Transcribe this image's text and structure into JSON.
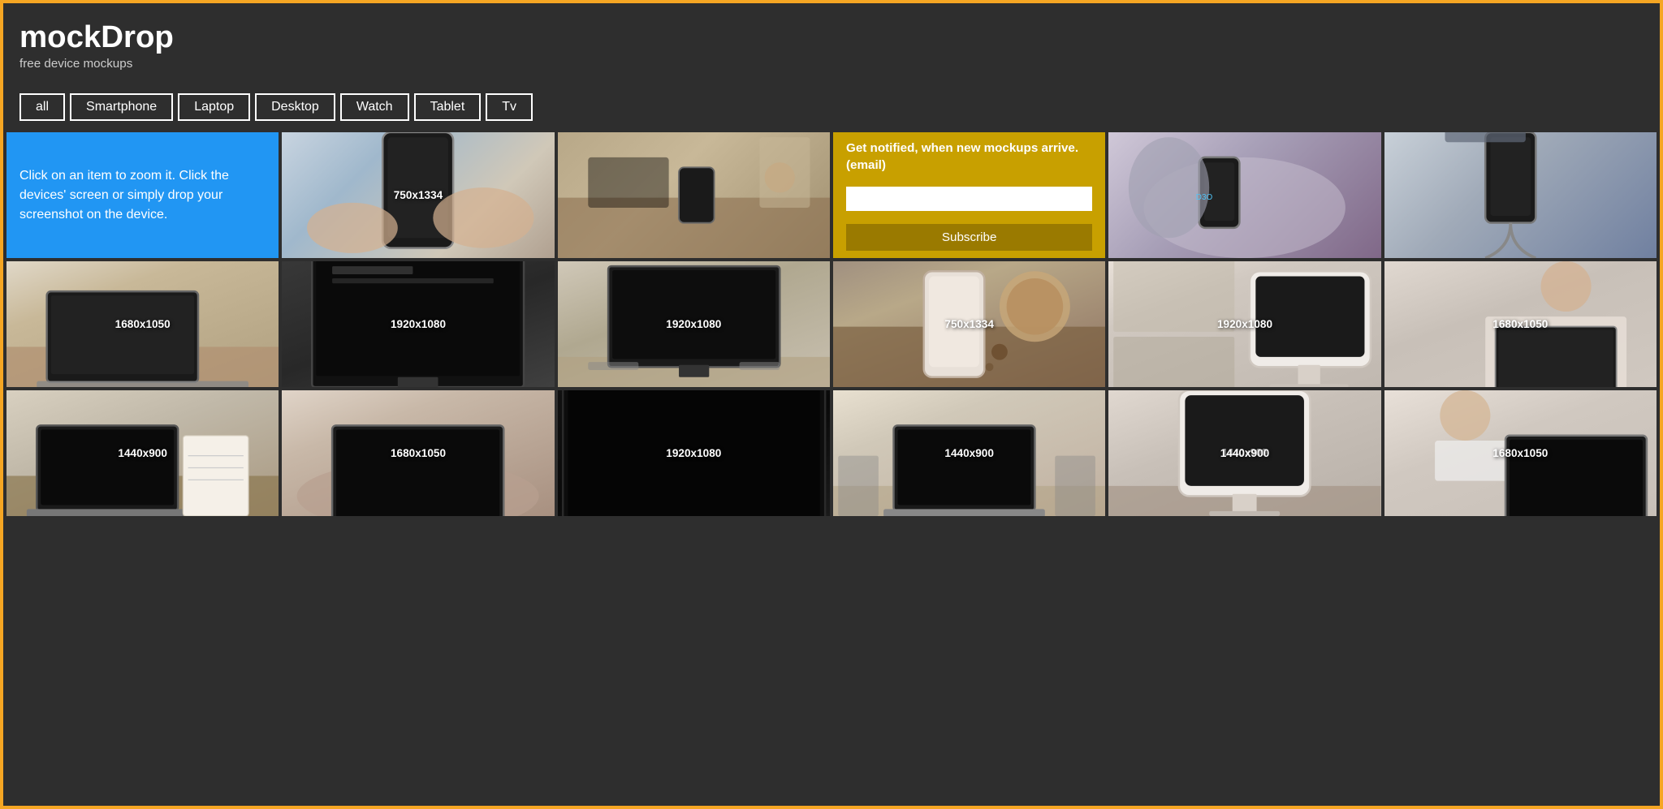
{
  "site": {
    "title": "mockDrop",
    "subtitle": "free device mockups",
    "border_color": "#f5a623"
  },
  "filters": {
    "active": "all",
    "items": [
      "all",
      "Smartphone",
      "Laptop",
      "Desktop",
      "Watch",
      "Tablet",
      "Tv"
    ]
  },
  "info_box": {
    "text": "Click on an item to zoom it. Click the devices' screen or simply drop your screenshot on the device."
  },
  "subscribe": {
    "heading": "Get notified, when new mockups arrive. (email)",
    "placeholder": "",
    "button_label": "Subscribe"
  },
  "grid": {
    "row1": [
      {
        "type": "info"
      },
      {
        "type": "mockup",
        "label": "750x1334",
        "photo": "phone-hand"
      },
      {
        "type": "mockup",
        "label": "",
        "photo": "phone-table"
      },
      {
        "type": "subscribe"
      },
      {
        "type": "mockup",
        "label": "",
        "photo": "phone-vr"
      },
      {
        "type": "mockup",
        "label": "",
        "photo": "phone-cables"
      }
    ],
    "row2": [
      {
        "type": "mockup",
        "label": "1680x1050",
        "photo": "laptop-table"
      },
      {
        "type": "mockup",
        "label": "1920x1080",
        "photo": "monitor-dark"
      },
      {
        "type": "mockup",
        "label": "1920x1080",
        "photo": "monitor-desk"
      },
      {
        "type": "mockup",
        "label": "750x1334",
        "photo": "phone-coffee"
      },
      {
        "type": "mockup",
        "label": "1920x1080",
        "photo": "imac-shelf"
      },
      {
        "type": "mockup",
        "label": "1680x1050",
        "photo": "man-laptop"
      }
    ],
    "row3": [
      {
        "type": "mockup",
        "label": "1440x900",
        "photo": "laptop-notebook"
      },
      {
        "type": "mockup",
        "label": "1680x1050",
        "photo": "laptop-sofa"
      },
      {
        "type": "mockup",
        "label": "1920x1080",
        "photo": "monitor-black"
      },
      {
        "type": "mockup",
        "label": "1440x900",
        "photo": "laptop-desk2"
      },
      {
        "type": "mockup",
        "label": "1440x900",
        "photo": "imac-desk"
      },
      {
        "type": "mockup",
        "label": "1680x1050",
        "photo": "man-type"
      }
    ]
  }
}
